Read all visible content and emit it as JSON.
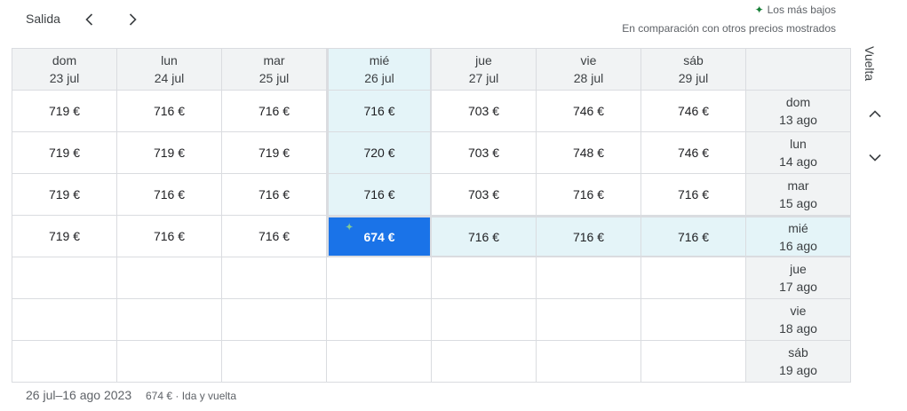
{
  "header": {
    "title": "Salida",
    "legend_low": "Los más bajos",
    "legend_sub": "En comparación con otros precios mostrados"
  },
  "side": {
    "return_label": "Vuelta"
  },
  "columns": [
    {
      "day": "dom",
      "date": "23 jul"
    },
    {
      "day": "lun",
      "date": "24 jul"
    },
    {
      "day": "mar",
      "date": "25 jul"
    },
    {
      "day": "mié",
      "date": "26 jul"
    },
    {
      "day": "jue",
      "date": "27 jul"
    },
    {
      "day": "vie",
      "date": "28 jul"
    },
    {
      "day": "sáb",
      "date": "29 jul"
    }
  ],
  "rows": [
    {
      "day": "dom",
      "date": "13 ago",
      "prices": [
        "719 €",
        "716 €",
        "716 €",
        "716 €",
        "703 €",
        "746 €",
        "746 €"
      ]
    },
    {
      "day": "lun",
      "date": "14 ago",
      "prices": [
        "719 €",
        "719 €",
        "719 €",
        "720 €",
        "703 €",
        "748 €",
        "746 €"
      ]
    },
    {
      "day": "mar",
      "date": "15 ago",
      "prices": [
        "719 €",
        "716 €",
        "716 €",
        "716 €",
        "703 €",
        "716 €",
        "716 €"
      ]
    },
    {
      "day": "mié",
      "date": "16 ago",
      "prices": [
        "719 €",
        "716 €",
        "716 €",
        "674 €",
        "716 €",
        "716 €",
        "716 €"
      ]
    },
    {
      "day": "jue",
      "date": "17 ago",
      "prices": [
        "",
        "",
        "",
        "",
        "",
        "",
        ""
      ]
    },
    {
      "day": "vie",
      "date": "18 ago",
      "prices": [
        "",
        "",
        "",
        "",
        "",
        "",
        ""
      ]
    },
    {
      "day": "sáb",
      "date": "19 ago",
      "prices": [
        "",
        "",
        "",
        "",
        "",
        "",
        ""
      ]
    }
  ],
  "selection": {
    "col": 3,
    "row": 3
  },
  "colors": {
    "accent": "#1a73e8",
    "highlight": "#e4f4f8",
    "low_price": "#188038"
  },
  "footer": {
    "dates": "26 jul–16 ago 2023",
    "summary": "674 € · Ida y vuelta"
  }
}
